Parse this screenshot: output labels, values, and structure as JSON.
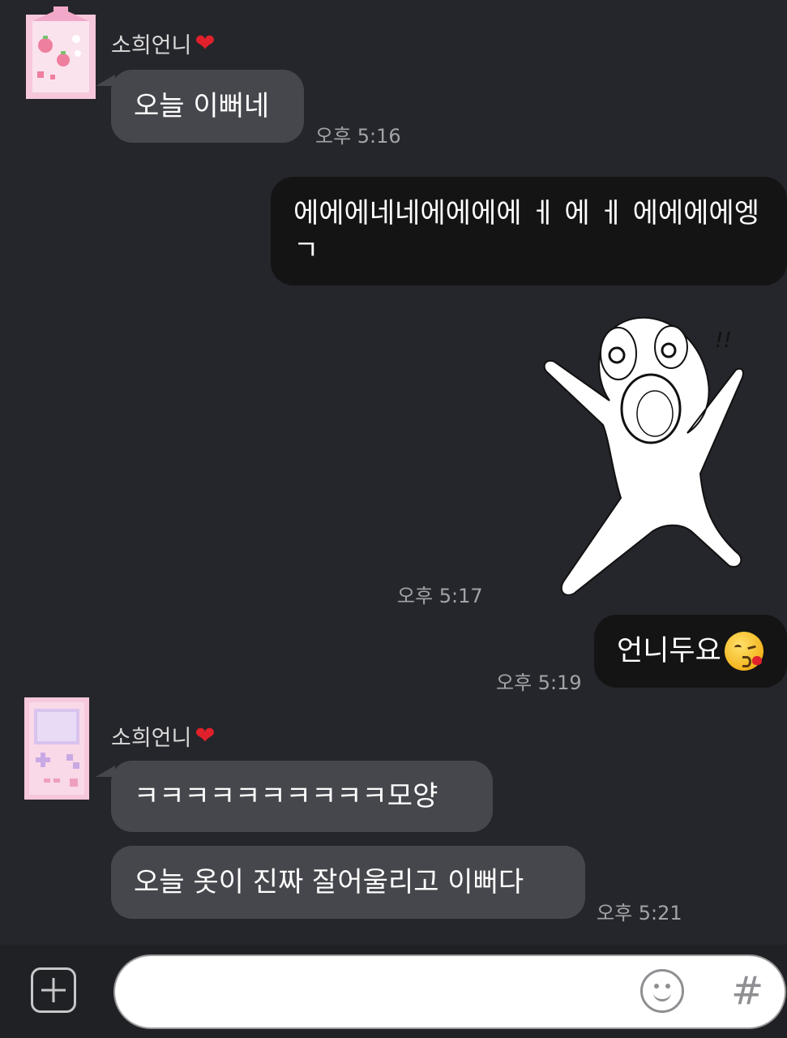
{
  "messages": {
    "group1": {
      "sender": "소희언니",
      "text": "오늘 이뻐네",
      "time": "오후 5:16"
    },
    "out1": {
      "line1": "에에에네네에에에에 ㅔ 에 ㅔ 에에에에엥",
      "line2": "ㄱ"
    },
    "sticker_time": "오후 5:17",
    "out2": {
      "text": "언니두요",
      "emoji": "kissing-face-emoji",
      "time": "오후 5:19"
    },
    "group2": {
      "sender": "소희언니",
      "text1": "ㅋㅋㅋㅋㅋㅋㅋㅋㅋㅋ모양",
      "text2": "오늘 옷이 진짜 잘어울리고 이뻐다",
      "time": "오후 5:21"
    }
  },
  "input_bar": {
    "placeholder": "",
    "plus_icon": "plus-icon",
    "emoji_icon": "smile-icon",
    "hash_label": "#"
  },
  "colors": {
    "background": "#25262b",
    "incoming_bubble": "#46474c",
    "outgoing_bubble": "#141414",
    "heart": "#e0202a"
  }
}
